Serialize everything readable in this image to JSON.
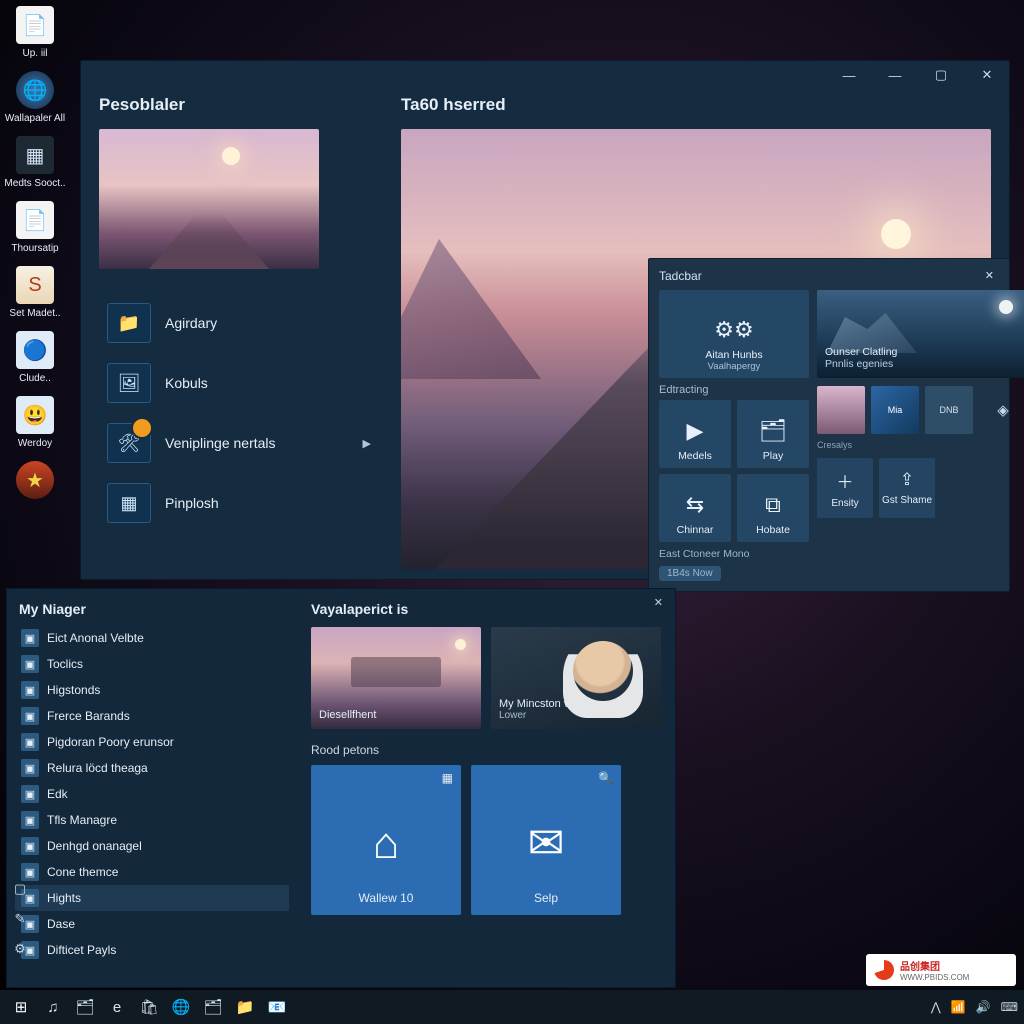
{
  "desktop": {
    "icons": [
      {
        "label": "Up. iil",
        "glyph": "📄",
        "cls": "paper"
      },
      {
        "label": "Wallapaler All",
        "glyph": "🌐",
        "cls": "globe"
      },
      {
        "label": "Medts Sooct..",
        "glyph": "▦",
        "cls": "dark"
      },
      {
        "label": "Thoursatip",
        "glyph": "📄",
        "cls": "paper"
      },
      {
        "label": "Set Madet..",
        "glyph": "S",
        "cls": "red"
      },
      {
        "label": "Clude..",
        "glyph": "🔵",
        "cls": "cheery"
      },
      {
        "label": "Werdoy",
        "glyph": "😃",
        "cls": "cheery"
      },
      {
        "label": "",
        "glyph": "★",
        "cls": "star"
      }
    ]
  },
  "main_window": {
    "left_title": "Pesoblaler",
    "right_title": "Ta60 hserred",
    "nav": [
      {
        "label": "Agirdary",
        "icon": "📁"
      },
      {
        "label": "Kobuls",
        "icon": "🖼"
      },
      {
        "label": "Veniplinge nertals",
        "icon": "🛠",
        "badge": true,
        "chevron": true
      },
      {
        "label": "Pinplosh",
        "icon": "▦"
      }
    ]
  },
  "panel2": {
    "title": "Tadcbar",
    "big_tile": {
      "line1": "Aitan Hunbs",
      "line2": "Vaalhapergy"
    },
    "section1": "Edtracting",
    "row1": [
      {
        "label": "Medels",
        "icon": "▶"
      },
      {
        "label": "Play",
        "icon": "🗂"
      }
    ],
    "row2": [
      {
        "label": "Chinnar",
        "icon": "⇆"
      },
      {
        "label": "Hobate",
        "icon": "⧉"
      }
    ],
    "footer": "East Ctoneer Mono",
    "pill": "1B4s Now",
    "wide": {
      "line1": "Ounser Clatling",
      "line2": "Pnnlis egenies"
    },
    "mini_labels": {
      "a": "Cresalys",
      "b": "Mia",
      "c": "DNB"
    },
    "sq": [
      {
        "label": "Ensity",
        "icon": "＋"
      },
      {
        "label": "Gst Shame",
        "icon": "⇪"
      }
    ]
  },
  "start": {
    "title": "My Niager",
    "items": [
      "Eict Anonal Velbte",
      "Toclics",
      "Higstonds",
      "Frerce Barands",
      "Pigdoran Poory erunsor",
      "Relura löcd theaga",
      "Edk",
      "Tfls Managre",
      "Denhgd onanagel",
      "Cone themce",
      "Hights",
      "Dase",
      "Difticet Payls"
    ],
    "selected_index": 10,
    "right_title": "Vayalaperict is",
    "cards": [
      {
        "label": "Diesellfhent"
      },
      {
        "label": "My Mincston v.",
        "sub": "Lower"
      }
    ],
    "group": "Rood petons",
    "big": [
      {
        "label": "Wallew 10",
        "icon": "⌂",
        "corner": "▦"
      },
      {
        "label": "Selp",
        "icon": "✉",
        "corner": "🔍"
      }
    ]
  },
  "taskbar": {
    "apps": [
      "⊞",
      "♫",
      "🗂",
      "e",
      "🛍",
      "🌐",
      "🗂",
      "📁",
      "📧"
    ],
    "tray": [
      "⋀",
      "📶",
      "🔊",
      "⌨"
    ]
  },
  "watermark": {
    "cn": "品创集团",
    "url": "WWW.PBIDS.COM"
  }
}
